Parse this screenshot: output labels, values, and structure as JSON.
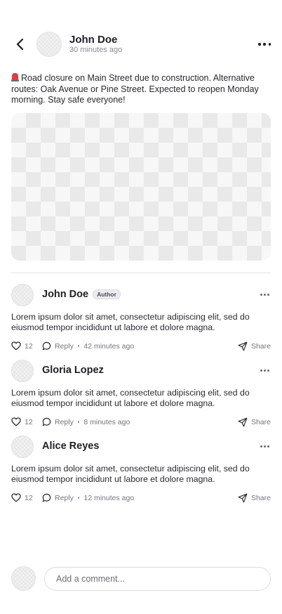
{
  "header": {
    "author_name": "John Doe",
    "timestamp": "30 minutes ago",
    "back_icon": "chevron-left-icon",
    "more_icon": "more-horizontal-icon"
  },
  "post": {
    "emoji_icon": "siren-icon",
    "text": "Road closure on Main Street due to construction. Alternative routes: Oak Avenue or Pine Street. Expected to reopen Monday morning. Stay safe everyone!",
    "image_placeholder": "transparent-checkerboard"
  },
  "comments": [
    {
      "name": "John Doe",
      "badge": "Author",
      "text": "Lorem ipsum dolor sit amet, consectetur adipiscing elit, sed do eiusmod tempor incididunt ut labore et dolore magna.",
      "likes": "12",
      "reply_label": "Reply",
      "time": "42 minutes ago",
      "share_label": "Share"
    },
    {
      "name": "Gloria Lopez",
      "badge": "",
      "text": "Lorem ipsum dolor sit amet, consectetur adipiscing elit, sed do eiusmod tempor incididunt ut labore et dolore magna.",
      "likes": "12",
      "reply_label": "Reply",
      "time": "8 minutes ago",
      "share_label": "Share"
    },
    {
      "name": "Alice Reyes",
      "badge": "",
      "text": "Lorem ipsum dolor sit amet, consectetur adipiscing elit, sed do eiusmod tempor incididunt ut labore et dolore magna.",
      "likes": "12",
      "reply_label": "Reply",
      "time": "12 minutes ago",
      "share_label": "Share"
    }
  ],
  "composer": {
    "placeholder": "Add a comment...",
    "value": ""
  },
  "colors": {
    "text": "#1f1f24",
    "muted": "#76767d",
    "divider": "#e4e4e8",
    "siren": "#e23b3b"
  }
}
